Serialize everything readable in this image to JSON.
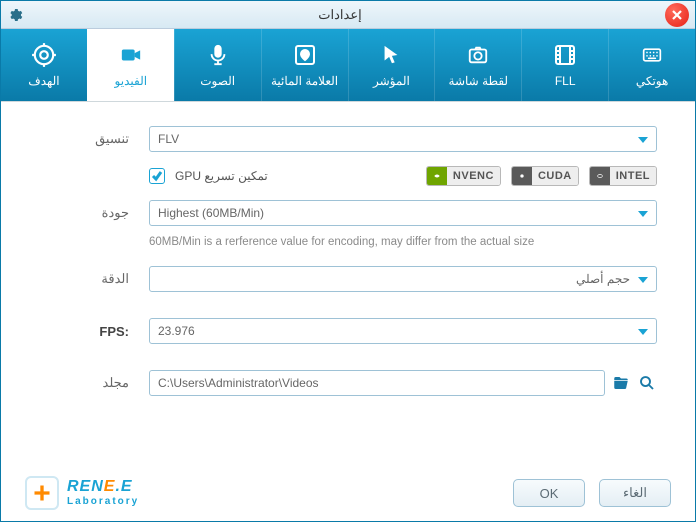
{
  "window": {
    "title": "إعدادات"
  },
  "tabs": {
    "target": "الهدف",
    "video": "الفيديو",
    "audio": "الصوت",
    "watermark": "العلامة المائية",
    "cursor": "المؤشر",
    "screenshot": "لقطة شاشة",
    "fll": "FLL",
    "hotkey": "هوتكي"
  },
  "labels": {
    "format": "تنسيق",
    "quality": "جودة",
    "resolution": "الدقة",
    "fps": "FPS:",
    "folder": "مجلد"
  },
  "format": {
    "value": "FLV"
  },
  "gpu": {
    "enable_label": "تمكين تسريع GPU",
    "checked": true,
    "enc": {
      "nvenc": "NVENC",
      "cuda": "CUDA",
      "intel": "INTEL"
    }
  },
  "quality": {
    "value": "Highest (60MB/Min)",
    "help": "60MB/Min is a rerference value for encoding, may differ from the actual size"
  },
  "resolution": {
    "value": "حجم أصلي"
  },
  "fps": {
    "value": "23.976"
  },
  "folder": {
    "value": "C:\\Users\\Administrator\\Videos"
  },
  "buttons": {
    "ok": "OK",
    "cancel": "الغاء"
  },
  "brand": {
    "line1": "RENE.E",
    "line2": "Laboratory"
  }
}
